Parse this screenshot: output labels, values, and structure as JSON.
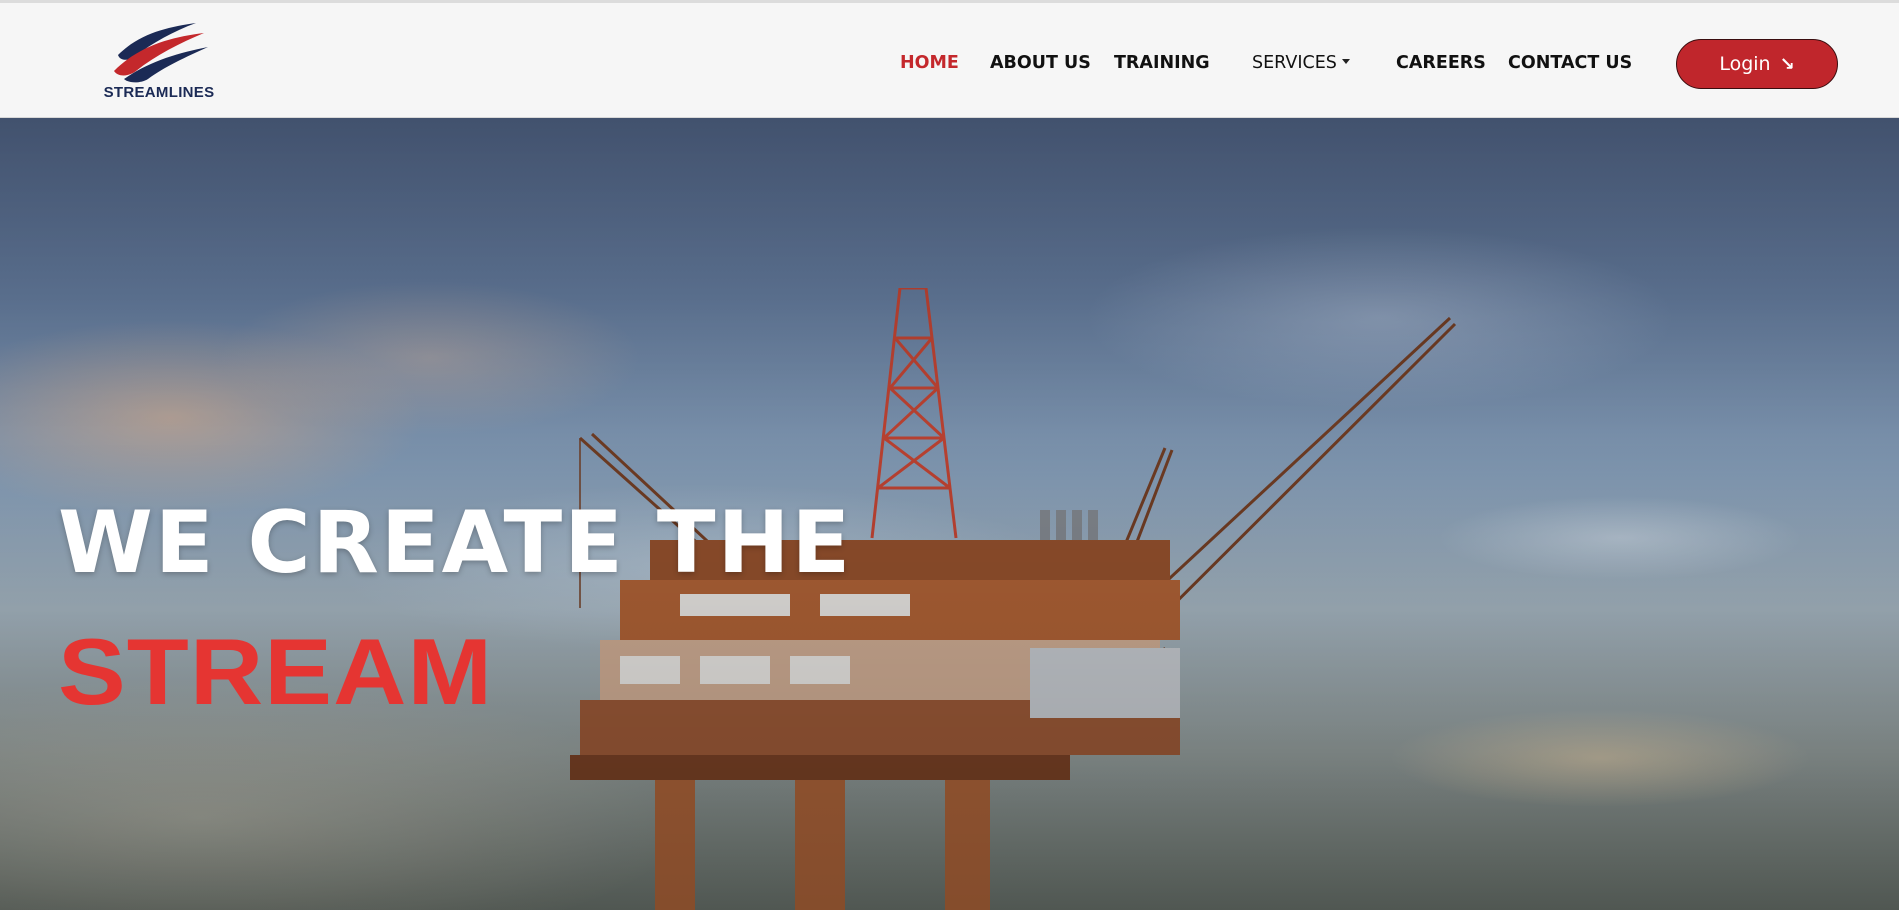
{
  "brand": {
    "name": "STREAMLINES",
    "colors": {
      "navy": "#1b2a55",
      "red": "#c4282c"
    }
  },
  "nav": {
    "items": [
      {
        "label": "HOME",
        "active": true
      },
      {
        "label": "ABOUT US"
      },
      {
        "label": "TRAINING"
      },
      {
        "label": "SERVICES",
        "dropdown": true
      },
      {
        "label": "CAREERS"
      },
      {
        "label": "CONTACT US"
      }
    ],
    "login": {
      "label": "Login",
      "icon": "arrow-down-right-icon",
      "arrow": "↘"
    }
  },
  "hero": {
    "title": "WE CREATE THE",
    "accent": "STREAM",
    "background": "offshore-oil-rig-at-sunset",
    "colors": {
      "title": "#ffffff",
      "accent": "#e53532"
    }
  }
}
